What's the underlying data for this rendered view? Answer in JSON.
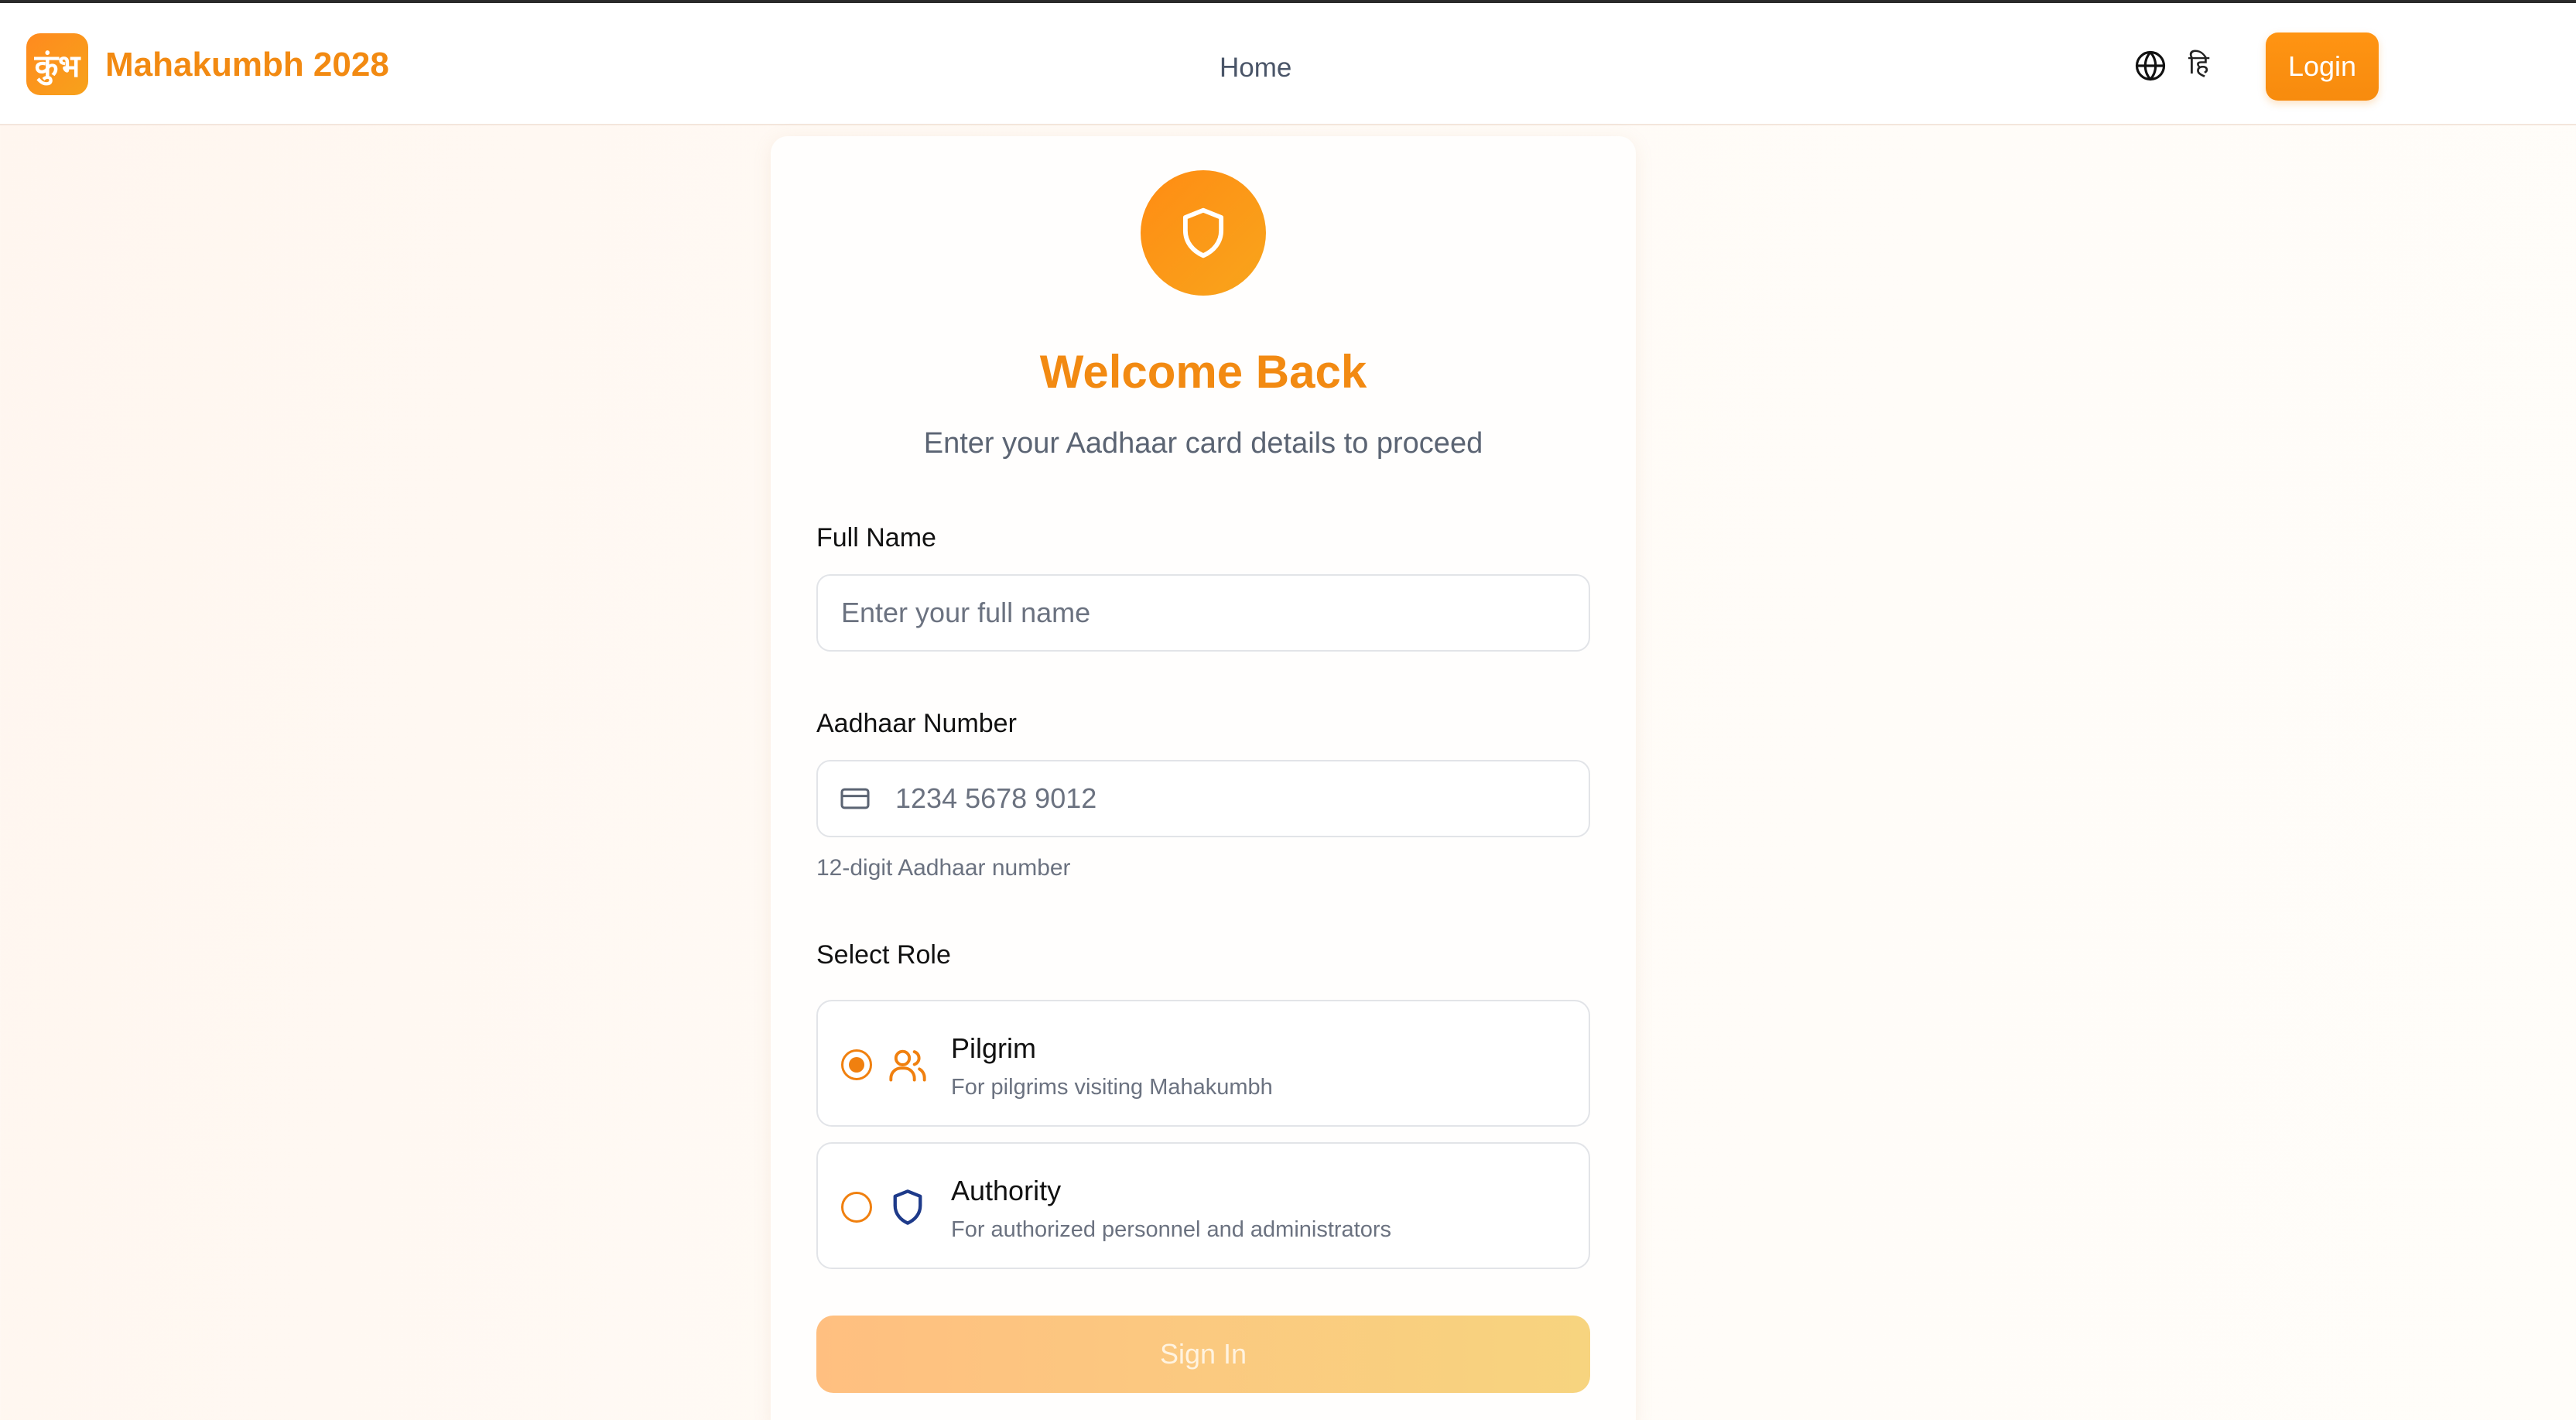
{
  "header": {
    "logo_text": "कुंभ",
    "brand": "Mahakumbh 2028",
    "nav_home": "Home",
    "language_toggle": "हि",
    "login_label": "Login"
  },
  "login_card": {
    "title": "Welcome Back",
    "subtitle": "Enter your Aadhaar card details to proceed",
    "full_name": {
      "label": "Full Name",
      "placeholder": "Enter your full name",
      "value": ""
    },
    "aadhaar": {
      "label": "Aadhaar Number",
      "placeholder": "1234 5678 9012",
      "value": "",
      "hint": "12-digit Aadhaar number"
    },
    "role": {
      "label": "Select Role",
      "selected": "Pilgrim",
      "options": [
        {
          "title": "Pilgrim",
          "description": "For pilgrims visiting Mahakumbh",
          "icon": "users-icon"
        },
        {
          "title": "Authority",
          "description": "For authorized personnel and administrators",
          "icon": "shield-icon"
        }
      ]
    },
    "submit_label": "Sign In"
  },
  "colors": {
    "accent": "#f28a12",
    "authority_icon": "#1e3a8a",
    "muted_text": "#6b7280"
  }
}
